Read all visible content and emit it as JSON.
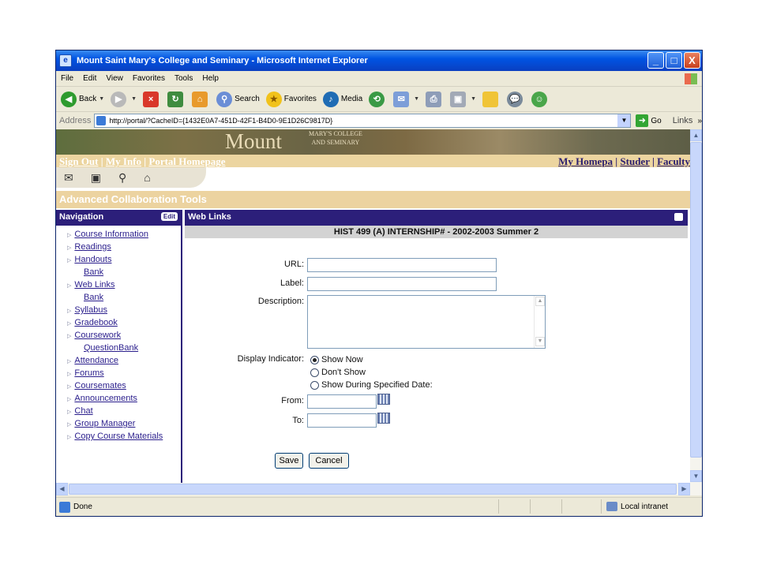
{
  "window": {
    "title": "Mount Saint Mary's College and Seminary - Microsoft Internet Explorer",
    "controls": {
      "minimize": "_",
      "maximize": "□",
      "close": "X"
    }
  },
  "menubar": [
    "File",
    "Edit",
    "View",
    "Favorites",
    "Tools",
    "Help"
  ],
  "toolbar": {
    "back_label": "Back",
    "search_label": "Search",
    "favorites_label": "Favorites",
    "media_label": "Media"
  },
  "address": {
    "label": "Address",
    "url": "http://portal/?CacheID={1432E0A7-451D-42F1-B4D0-9E1D26C9817D}",
    "go_label": "Go",
    "links_label": "Links"
  },
  "banner": {
    "title": "Mount",
    "subtitle_line1": "MARY'S COLLEGE",
    "subtitle_line2": "AND SEMINARY"
  },
  "portal_nav": {
    "left": [
      "Sign Out",
      "My Info",
      "Portal Homepage"
    ],
    "right": [
      "My Homepa",
      "Studer",
      "Faculty"
    ],
    "separator": "|"
  },
  "section_title": "Advanced Collaboration Tools",
  "navigation": {
    "title": "Navigation",
    "edit_label": "Edit",
    "items": [
      {
        "label": "Course Information"
      },
      {
        "label": "Readings"
      },
      {
        "label": "Handouts"
      },
      {
        "label": "Bank"
      },
      {
        "label": "Web Links"
      },
      {
        "label": "Bank"
      },
      {
        "label": "Syllabus"
      },
      {
        "label": "Gradebook"
      },
      {
        "label": "Coursework"
      },
      {
        "label": "QuestionBank"
      },
      {
        "label": "Attendance"
      },
      {
        "label": "Forums"
      },
      {
        "label": "Coursemates"
      },
      {
        "label": "Announcements"
      },
      {
        "label": "Chat"
      },
      {
        "label": "Group Manager"
      },
      {
        "label": "Copy Course Materials"
      }
    ]
  },
  "weblinks": {
    "title": "Web Links",
    "course": "HIST 499 (A) INTERNSHIP# - 2002-2003 Summer 2",
    "url_label": "URL:",
    "label_label": "Label:",
    "description_label": "Description:",
    "display_label": "Display Indicator:",
    "options": [
      "Show Now",
      "Don't Show",
      "Show During Specified Date:"
    ],
    "selected_option": "Show Now",
    "from_label": "From:",
    "to_label": "To:",
    "save_label": "Save",
    "cancel_label": "Cancel"
  },
  "status": {
    "text": "Done",
    "zone": "Local intranet"
  }
}
